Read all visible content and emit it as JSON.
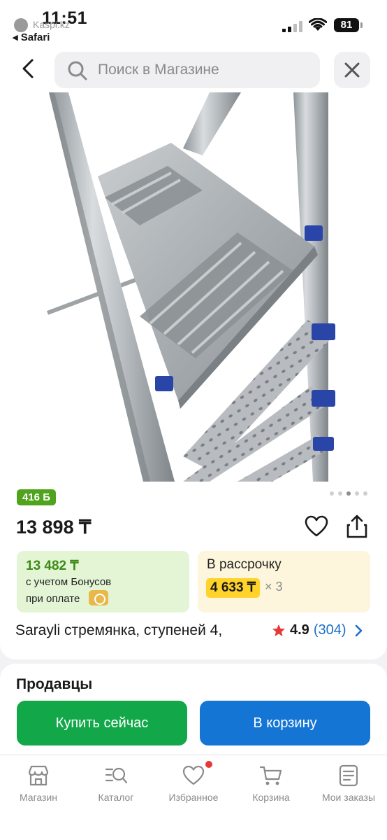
{
  "status_bar": {
    "time": "11:51",
    "site": "Kaspi.kz",
    "back_app": "◂ Safari",
    "battery": "81"
  },
  "search": {
    "placeholder": "Поиск в Магазине"
  },
  "product": {
    "bonus_badge": "416 Б",
    "image_count": 5,
    "image_active_index": 2,
    "price": "13 898 ₸",
    "bonus_price": "13 482 ₸",
    "bonus_line1": "с учетом Бонусов",
    "bonus_line2": "при оплате",
    "installment_label": "В рассрочку",
    "installment_amount": "4 633 ₸",
    "installment_multiplier": "× 3",
    "title": "Sarayli стремянка, ступеней 4,",
    "rating": "4.9",
    "reviews": "(304)"
  },
  "sellers": {
    "heading": "Продавцы",
    "buy_now": "Купить сейчас",
    "to_cart": "В корзину"
  },
  "tabs": [
    {
      "label": "Магазин",
      "icon": "shop-icon"
    },
    {
      "label": "Каталог",
      "icon": "catalog-icon"
    },
    {
      "label": "Избранное",
      "icon": "heart-icon"
    },
    {
      "label": "Корзина",
      "icon": "cart-icon"
    },
    {
      "label": "Мои заказы",
      "icon": "orders-icon"
    }
  ],
  "colors": {
    "green": "#12a84a",
    "blue": "#1475d4",
    "bonus_green": "#4fa31d",
    "installment_yellow": "#ffd32a",
    "star": "#e53935"
  }
}
